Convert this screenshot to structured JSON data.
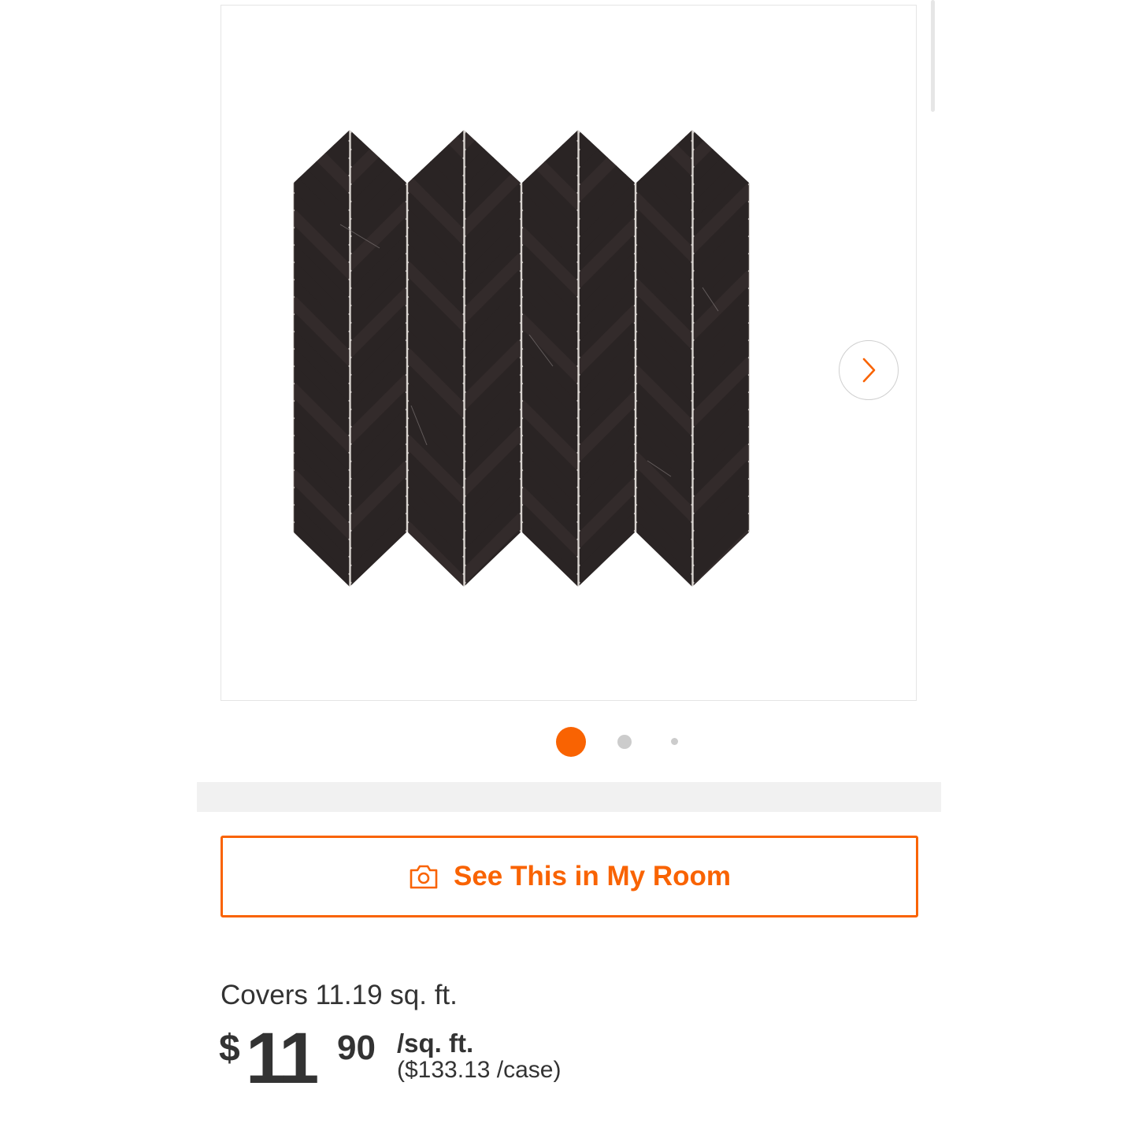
{
  "gallery": {
    "image_alt": "black marble herringbone mosaic tile",
    "next_icon": "chevron-right-icon",
    "slide_count": 3,
    "active_slide": 1
  },
  "actions": {
    "room_button_label": "See This in My Room",
    "room_button_icon": "camera-icon"
  },
  "pricing": {
    "coverage": "Covers 11.19 sq. ft.",
    "currency": "$",
    "whole": "11",
    "cents": "90",
    "unit": "/sq. ft.",
    "case_price": "($133.13 /case)"
  },
  "colors": {
    "accent": "#f96302",
    "text": "#333333",
    "tile": "#2a2424",
    "grout": "#d9d4d0"
  }
}
